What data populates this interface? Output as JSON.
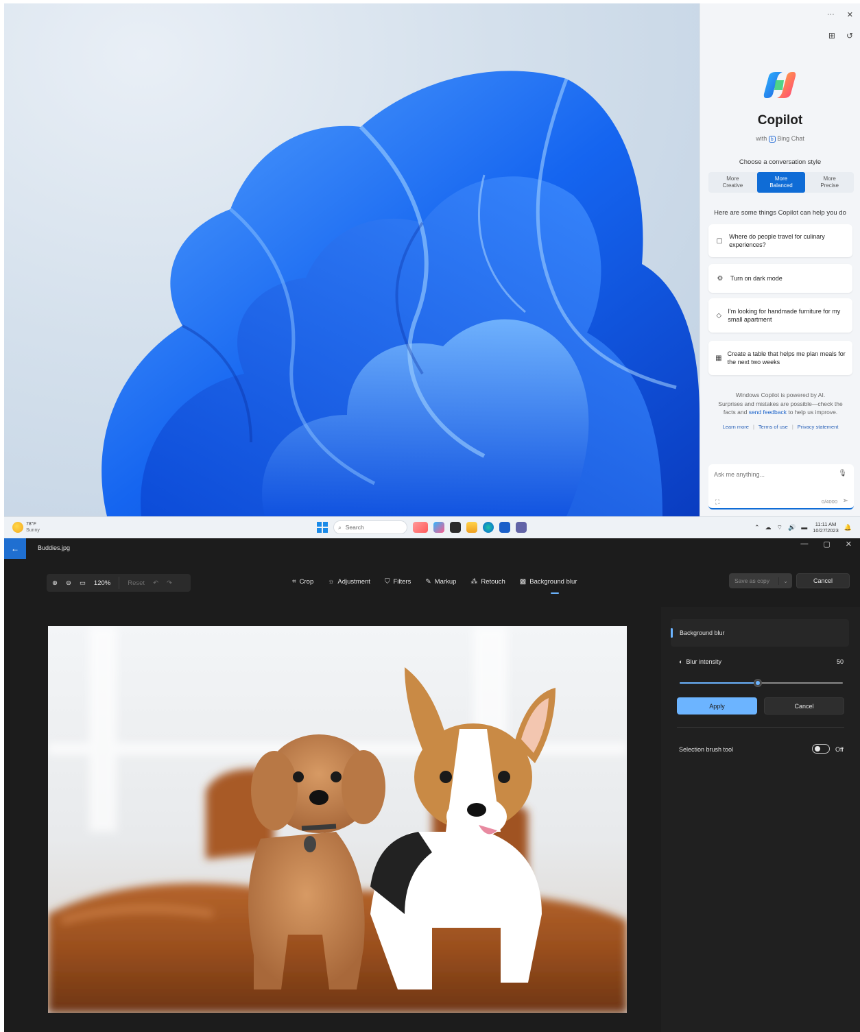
{
  "copilot": {
    "topbar": {
      "more": "···",
      "close": "✕"
    },
    "title": "Copilot",
    "subtitle_prefix": "with",
    "subtitle_brand": "Bing Chat",
    "choose_label": "Choose a conversation style",
    "styles": [
      {
        "label": "More\nCreative",
        "active": false
      },
      {
        "label": "More\nBalanced",
        "active": true
      },
      {
        "label": "More\nPrecise",
        "active": false
      }
    ],
    "help_label": "Here are some things Copilot can help you do",
    "suggestions": [
      {
        "icon": "briefcase-icon",
        "glyph": "▢",
        "text": "Where do people travel for culinary experiences?"
      },
      {
        "icon": "settings-icon",
        "glyph": "⚙",
        "text": "Turn on dark mode"
      },
      {
        "icon": "tag-icon",
        "glyph": "◇",
        "text": "I'm looking for handmade furniture for my small apartment"
      },
      {
        "icon": "table-icon",
        "glyph": "▦",
        "text": "Create a table that helps me plan meals for the next two weeks"
      }
    ],
    "disclaimer_line1": "Windows Copilot is powered by AI.",
    "disclaimer_line2": "Surprises and mistakes are possible—check the",
    "disclaimer_line3_pre": "facts and",
    "disclaimer_link": "send feedback",
    "disclaimer_line3_post": "to help us improve.",
    "links": [
      "Learn more",
      "Terms of use",
      "Privacy statement"
    ],
    "input_placeholder": "Ask me anything...",
    "char_count": "0/4000"
  },
  "taskbar": {
    "temperature": "78°F",
    "condition": "Sunny",
    "search_placeholder": "Search",
    "time": "11:11 AM",
    "date": "10/27/2023"
  },
  "photos": {
    "filename": "Buddies.jpg",
    "zoom_level": "120%",
    "reset_label": "Reset",
    "tools": [
      {
        "id": "crop",
        "glyph": "⌗",
        "label": "Crop",
        "active": false
      },
      {
        "id": "adjustment",
        "glyph": "☼",
        "label": "Adjustment",
        "active": false
      },
      {
        "id": "filters",
        "glyph": "⛉",
        "label": "Filters",
        "active": false
      },
      {
        "id": "markup",
        "glyph": "✎",
        "label": "Markup",
        "active": false
      },
      {
        "id": "retouch",
        "glyph": "⁂",
        "label": "Retouch",
        "active": false
      },
      {
        "id": "background-blur",
        "glyph": "▩",
        "label": "Background blur",
        "active": true
      }
    ],
    "save_label": "Save as copy",
    "cancel_top_label": "Cancel",
    "panel": {
      "title": "Background blur",
      "blur_label": "Blur intensity",
      "blur_value": "50",
      "blur_fraction": 0.48,
      "apply_label": "Apply",
      "cancel_label": "Cancel",
      "brush_label": "Selection brush tool",
      "brush_state": "Off"
    }
  },
  "colors": {
    "accent_blue": "#0f6cd6",
    "photos_accent": "#6cb4ff"
  }
}
